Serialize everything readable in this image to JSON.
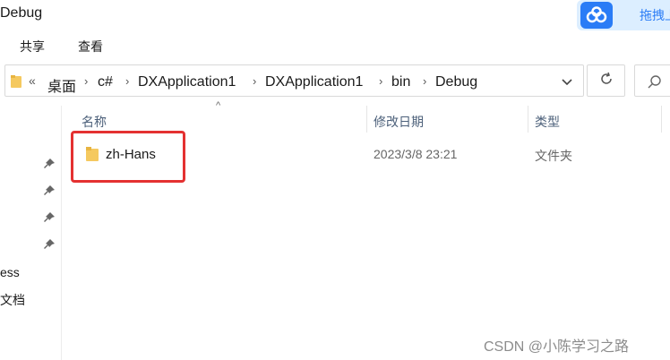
{
  "window": {
    "title": "Debug"
  },
  "cloud_widget": {
    "icon": "cloud-icon",
    "label": "拖拽上"
  },
  "ribbon": {
    "tabs": [
      "共享",
      "查看"
    ]
  },
  "address_bar": {
    "overflow_label": "«",
    "breadcrumbs": [
      "桌面",
      "c#",
      "DXApplication1",
      "DXApplication1",
      "bin",
      "Debug"
    ],
    "separator": "›"
  },
  "nav_pane": {
    "items": [
      "ess",
      "文档"
    ]
  },
  "columns": {
    "name": "名称",
    "date_modified": "修改日期",
    "type": "类型"
  },
  "files": [
    {
      "name": "zh-Hans",
      "date_modified": "2023/3/8 23:21",
      "type": "文件夹",
      "icon": "folder-icon"
    }
  ],
  "annotation": {
    "color": "#e43131"
  },
  "watermark": "CSDN @小陈学习之路",
  "colors": {
    "accent": "#2a7cf6",
    "folder": "#f5c95f"
  }
}
